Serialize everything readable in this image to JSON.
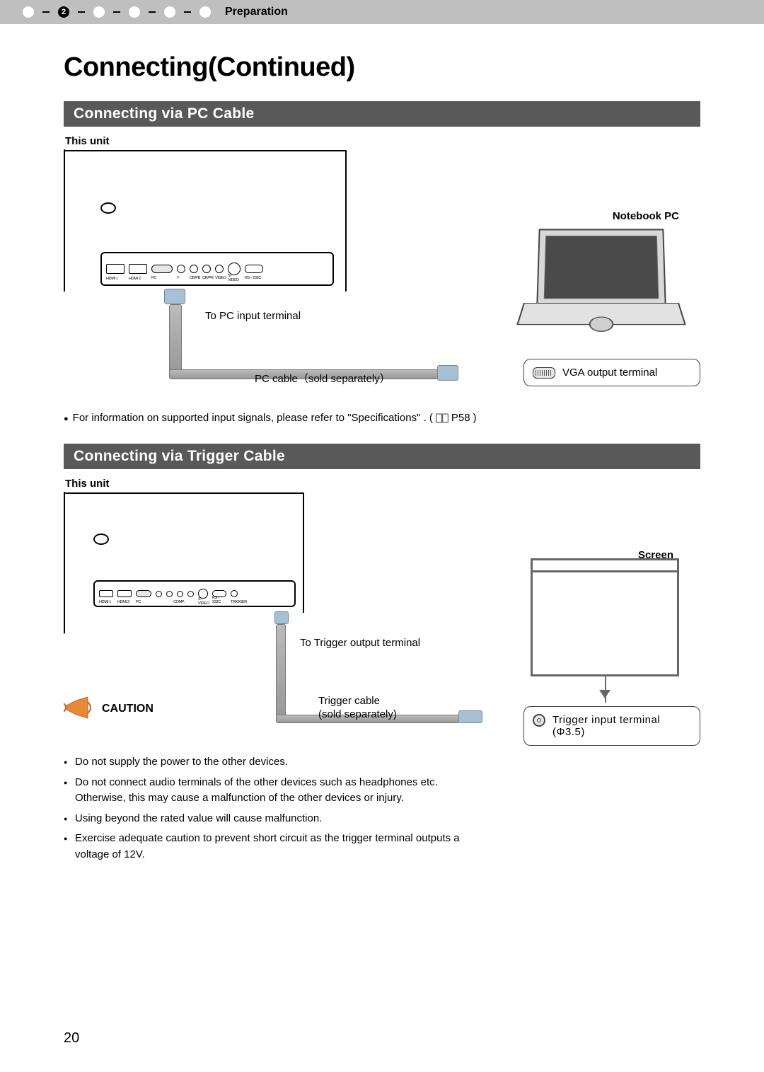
{
  "breadcrumb": {
    "label": "Preparation",
    "active_step": 2,
    "total_steps": 6
  },
  "title": "Connecting(Continued)",
  "section_pc": {
    "heading": "Connecting via PC Cable",
    "this_unit": "This unit",
    "to_pc_terminal": "To PC input terminal",
    "pc_cable_note": "PC cable（sold separately）",
    "notebook_label": "Notebook PC",
    "vga_output": "VGA output terminal",
    "ports": {
      "hdmi1": "HDMI 1",
      "hdmi2": "HDMI 2",
      "pc": "PC",
      "y": "Y",
      "cbpb": "CB/PB",
      "crpr": "CR/PR",
      "video": "VIDEO",
      "svideo": "S-VIDEO",
      "rs232c": "RS - 232C"
    },
    "footnote_pre": "For information on supported input signals, please refer to \"Specifications\" . (",
    "footnote_ref": "P58",
    "footnote_post": ")"
  },
  "section_trigger": {
    "heading": "Connecting via Trigger Cable",
    "this_unit": "This unit",
    "to_trigger_terminal": "To Trigger output terminal",
    "trigger_cable_line1": "Trigger cable",
    "trigger_cable_line2": "(sold separately)",
    "screen_label": "Screen",
    "trigger_box_line1": "Trigger input terminal",
    "trigger_box_line2": "(Φ3.5)",
    "caution": "CAUTION",
    "ports": {
      "hdmi1": "HDMI 1",
      "hdmi2": "HDMI 2",
      "pc": "PC",
      "comp": "COMP.",
      "svideo": "S-VIDEO",
      "rs232c": "RS - 232C",
      "trigger": "TRIGGER"
    },
    "bullets": [
      "Do not supply the power to the other devices.",
      "Do not connect audio terminals of the other devices such as headphones etc. Otherwise, this may cause a malfunction of the other devices or injury.",
      "Using beyond the rated value will cause malfunction.",
      "Exercise adequate caution to prevent short circuit as the trigger terminal outputs a voltage of 12V."
    ]
  },
  "page_number": "20"
}
